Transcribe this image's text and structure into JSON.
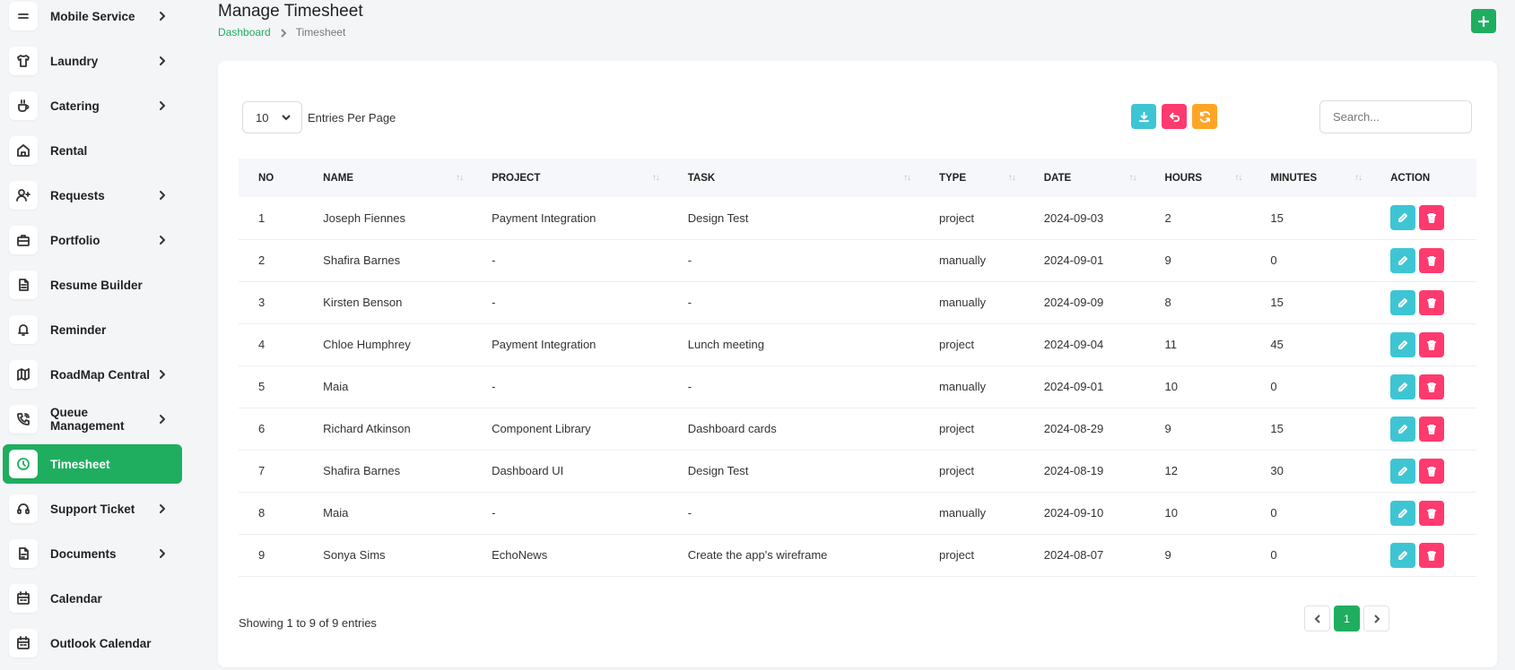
{
  "sidebar": {
    "items": [
      {
        "label": "Mobile Service",
        "icon": "menu-icon",
        "chevron": true
      },
      {
        "label": "Laundry",
        "icon": "shirt-icon",
        "chevron": true
      },
      {
        "label": "Catering",
        "icon": "coffee-icon",
        "chevron": true
      },
      {
        "label": "Rental",
        "icon": "home-icon",
        "chevron": false
      },
      {
        "label": "Requests",
        "icon": "user-plus-icon",
        "chevron": true
      },
      {
        "label": "Portfolio",
        "icon": "briefcase-icon",
        "chevron": true
      },
      {
        "label": "Resume Builder",
        "icon": "file-text-icon",
        "chevron": false
      },
      {
        "label": "Reminder",
        "icon": "bell-icon",
        "chevron": false
      },
      {
        "label": "RoadMap Central",
        "icon": "map-icon",
        "chevron": true
      },
      {
        "label": "Queue Management",
        "icon": "phone-call-icon",
        "chevron": true
      },
      {
        "label": "Timesheet",
        "icon": "clock-icon",
        "chevron": false,
        "active": true
      },
      {
        "label": "Support Ticket",
        "icon": "headphones-icon",
        "chevron": true
      },
      {
        "label": "Documents",
        "icon": "file-icon",
        "chevron": true
      },
      {
        "label": "Calendar",
        "icon": "calendar-icon",
        "chevron": false
      },
      {
        "label": "Outlook Calendar",
        "icon": "calendar-icon",
        "chevron": false
      }
    ]
  },
  "header": {
    "title": "Manage Timesheet",
    "breadcrumb": {
      "home": "Dashboard",
      "current": "Timesheet"
    }
  },
  "controls": {
    "entries_value": "10",
    "entries_label": "Entries Per Page",
    "search_placeholder": "Search..."
  },
  "table": {
    "columns": [
      "NO",
      "NAME",
      "PROJECT",
      "TASK",
      "TYPE",
      "DATE",
      "HOURS",
      "MINUTES",
      "ACTION"
    ],
    "rows": [
      [
        "1",
        "Joseph Fiennes",
        "Payment Integration",
        "Design Test",
        "project",
        "2024-09-03",
        "2",
        "15"
      ],
      [
        "2",
        "Shafira Barnes",
        "-",
        "-",
        "manually",
        "2024-09-01",
        "9",
        "0"
      ],
      [
        "3",
        "Kirsten Benson",
        "-",
        "-",
        "manually",
        "2024-09-09",
        "8",
        "15"
      ],
      [
        "4",
        "Chloe Humphrey",
        "Payment Integration",
        "Lunch meeting",
        "project",
        "2024-09-04",
        "11",
        "45"
      ],
      [
        "5",
        "Maia",
        "-",
        "-",
        "manually",
        "2024-09-01",
        "10",
        "0"
      ],
      [
        "6",
        "Richard Atkinson",
        "Component Library",
        "Dashboard cards",
        "project",
        "2024-08-29",
        "9",
        "15"
      ],
      [
        "7",
        "Shafira Barnes",
        "Dashboard UI",
        "Design Test",
        "project",
        "2024-08-19",
        "12",
        "30"
      ],
      [
        "8",
        "Maia",
        "-",
        "-",
        "manually",
        "2024-09-10",
        "10",
        "0"
      ],
      [
        "9",
        "Sonya Sims",
        "EchoNews",
        "Create the app's wireframe",
        "project",
        "2024-08-07",
        "9",
        "0"
      ]
    ]
  },
  "footer": {
    "showing": "Showing 1 to 9 of 9 entries",
    "current_page": "1"
  },
  "colors": {
    "accent": "#1fae5f",
    "info": "#3ec5d4",
    "danger": "#ff3a6e",
    "warning": "#ffa526"
  }
}
